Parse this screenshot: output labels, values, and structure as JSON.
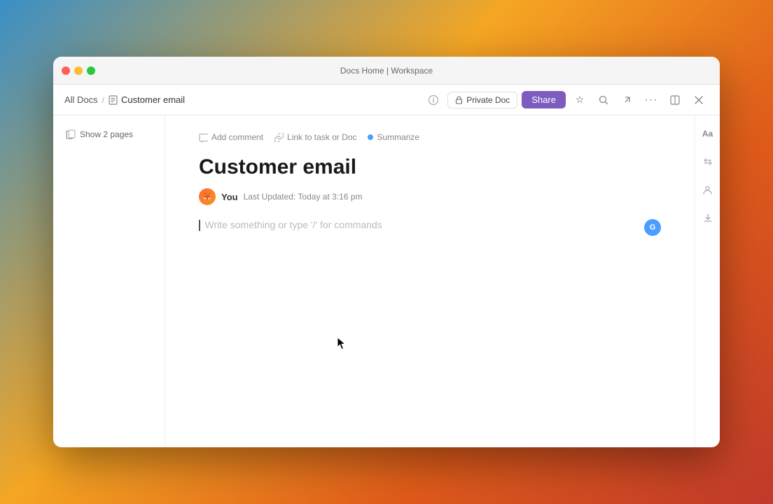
{
  "window": {
    "title": "Docs Home | Workspace",
    "traffic_lights": {
      "close_label": "close",
      "minimize_label": "minimize",
      "maximize_label": "maximize"
    }
  },
  "breadcrumb": {
    "all_docs": "All Docs",
    "separator": "/",
    "current": "Customer email"
  },
  "toolbar": {
    "private_doc_label": "Private Doc",
    "share_label": "Share",
    "lock_icon": "🔒",
    "star_icon": "☆",
    "search_icon": "⌕",
    "export_icon": "↗",
    "more_icon": "···",
    "split_icon": "⊡",
    "close_icon": "✕"
  },
  "sidebar": {
    "show_pages_label": "Show 2 pages",
    "pages_icon": "⊞"
  },
  "editor_toolbar": {
    "add_comment": "Add comment",
    "link_task": "Link to task or Doc",
    "summarize": "Summarize",
    "comment_icon": "💬",
    "link_icon": "🔗"
  },
  "document": {
    "title": "Customer email",
    "author": "You",
    "last_updated": "Last Updated: Today at 3:16 pm",
    "placeholder": "Write something or type '/' for commands",
    "avatar_emoji": "🦊"
  },
  "right_sidebar": {
    "text_format_icon": "Aa",
    "resize_icon": "⇕",
    "people_icon": "👤",
    "download_icon": "↓",
    "ai_label": "G"
  }
}
